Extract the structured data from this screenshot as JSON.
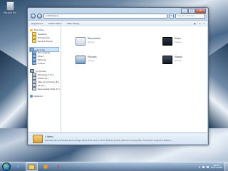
{
  "desktop": {
    "icons": [
      {
        "label": "Recycle Bin"
      }
    ]
  },
  "window": {
    "address_path": "▸ Libraries ▸",
    "search_placeholder": "Search Libraries",
    "toolbar": {
      "organize": "Organize ▾",
      "share": "Share with ▾",
      "new_library": "New library"
    },
    "nav": {
      "favorites": "Favorites",
      "desktop": "Desktop",
      "downloads": "Downloads",
      "recent": "Recent Places",
      "libraries": "Libraries",
      "documents": "Documents",
      "music": "Music",
      "pictures": "Pictures",
      "videos": "Videos",
      "computer": "Computer",
      "drives": [
        "Windows 7 (C:)",
        "VISTA (D:)",
        "Mes documents (E:)",
        "XP (G:)",
        "Removable Disk (H:)"
      ],
      "network": "Network"
    },
    "libraries": [
      {
        "name": "Documents",
        "type": "Library"
      },
      {
        "name": "Music",
        "type": "Library"
      },
      {
        "name": "Pictures",
        "type": "Library"
      },
      {
        "name": "Videos",
        "type": "Library"
      }
    ],
    "details": {
      "count": "4 items",
      "text": "Libraries let you access and arrange items from one or more folders quickly without moving them from their original locations."
    }
  },
  "taskbar": {
    "time": "09:45",
    "date": "29/01/2009"
  }
}
